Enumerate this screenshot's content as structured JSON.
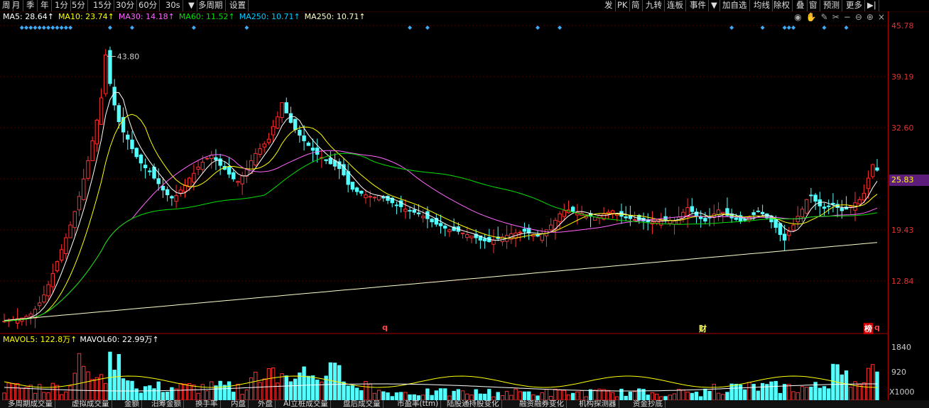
{
  "toolbar": {
    "left": [
      "周",
      "月",
      "季",
      "年",
      "1分",
      "5分",
      "15分",
      "30分",
      "60分",
      "30s",
      "▼",
      "多周期",
      "设置"
    ],
    "right": [
      "发",
      "PK",
      "简",
      "九转",
      "连板",
      "事件",
      "▼",
      "加自选",
      "均线",
      "除权",
      "叠",
      "窗",
      "预测",
      "更多",
      "▶|"
    ]
  },
  "ma_legend": [
    {
      "label": "MA5: 28.64↑",
      "color": "#ffffff"
    },
    {
      "label": "MA10: 23.74↑",
      "color": "#ffff00"
    },
    {
      "label": "MA30: 14.18↑",
      "color": "#ff66ff"
    },
    {
      "label": "MA60: 11.52↑",
      "color": "#00e000"
    },
    {
      "label": "MA250: 10.71↑",
      "color": "#00ccff"
    },
    {
      "label": "MA250: 10.71↑",
      "color": "#ffffcc"
    }
  ],
  "tools_icons": [
    "eye-icon",
    "hand-icon",
    "pen-icon",
    "scissors-icon",
    "minus-icon",
    "zoom-out-icon",
    "zoom-in-icon",
    "close-icon"
  ],
  "price_axis": [
    "45.78",
    "39.19",
    "32.60",
    "25.83",
    "19.43",
    "12.84"
  ],
  "current_price": "25.83",
  "peak_label": "43.80",
  "vol_legend": [
    {
      "label": "MAVOL5: 122.8万↑",
      "color": "#ffff00"
    },
    {
      "label": "MAVOL60: 22.99万↑",
      "color": "#ffffff"
    }
  ],
  "vol_axis": [
    "1840",
    "920"
  ],
  "vol_unit": "X1000",
  "markers": {
    "q1": "q",
    "cai": "财",
    "bang": "榜",
    "q2": "q"
  },
  "bottom_tabs": [
    "多周期成交量",
    "虚拟成交量",
    "金额",
    "汨筹金额",
    "换手率",
    "内盘",
    "外盘",
    "AI立桩成交量",
    "盘后成交量",
    "市盈率(ttm)",
    "陆股通持股变化",
    "融资融券变化",
    "机构探测器",
    "资金抄底"
  ],
  "chart_data": {
    "type": "candlestick",
    "ylim": [
      10.0,
      47.5
    ],
    "closes": [
      10.3,
      10.4,
      10.5,
      10.6,
      10.7,
      10.9,
      11.2,
      11.8,
      12.6,
      13.6,
      14.9,
      16.3,
      17.8,
      19.3,
      20.8,
      22.4,
      24.1,
      26.0,
      28.2,
      30.5,
      33.0,
      35.6,
      38.4,
      43.8,
      40.2,
      37.5,
      35.4,
      34.1,
      33.2,
      32.0,
      31.0,
      30.2,
      29.6,
      29.1,
      28.3,
      27.6,
      26.8,
      26.2,
      25.8,
      26.1,
      26.8,
      27.4,
      28.3,
      28.9,
      29.7,
      30.3,
      30.8,
      31.2,
      30.6,
      29.9,
      29.4,
      28.8,
      28.2,
      27.9,
      28.6,
      29.4,
      30.5,
      31.4,
      32.0,
      32.6,
      33.2,
      34.8,
      36.0,
      37.8,
      36.5,
      35.3,
      34.4,
      33.7,
      33.0,
      32.4,
      31.8,
      31.3,
      30.9,
      30.5,
      30.1,
      29.8,
      29.5,
      28.7,
      27.5,
      26.9,
      26.6,
      26.4,
      26.2,
      26.0,
      25.9,
      26.1,
      25.8,
      25.5,
      25.2,
      24.9,
      24.7,
      24.4,
      24.2,
      24.0,
      23.8,
      23.5,
      23.2,
      22.8,
      22.5,
      22.3,
      22.0,
      21.8,
      21.7,
      21.6,
      21.4,
      21.2,
      21.0,
      20.8,
      20.5,
      20.4,
      20.3,
      20.5,
      20.7,
      20.9,
      21.1,
      21.3,
      21.4,
      21.5,
      21.6,
      21.4,
      21.2,
      21.0,
      21.3,
      21.8,
      22.4,
      23.0,
      23.8,
      24.2,
      24.3,
      24.1,
      24.0,
      23.9,
      23.7,
      23.5,
      23.4,
      23.6,
      23.8,
      24.0,
      24.2,
      23.8,
      23.5,
      23.3,
      23.2,
      23.1,
      23.0,
      22.9,
      22.8,
      22.8,
      22.9,
      23.0,
      23.1,
      23.0,
      22.9,
      23.4,
      24.0,
      24.6,
      24.1,
      23.6,
      23.2,
      22.9,
      23.3,
      23.8,
      24.3,
      24.0,
      23.6,
      23.3,
      23.1,
      22.9,
      23.0,
      23.4,
      23.7,
      24.1,
      23.8,
      23.3,
      22.8,
      22.1,
      21.2,
      20.5,
      21.6,
      22.4,
      23.5,
      24.4,
      25.6,
      26.1,
      25.4,
      24.8,
      24.5,
      24.8,
      25.0,
      24.6,
      24.2,
      24.4,
      24.8,
      25.2,
      25.6,
      26.4,
      28.3,
      30.0,
      29.3
    ],
    "ma_series": [
      "MA5",
      "MA10",
      "MA30",
      "MA60",
      "MA250"
    ],
    "volume_axis": [
      0,
      1840
    ]
  }
}
